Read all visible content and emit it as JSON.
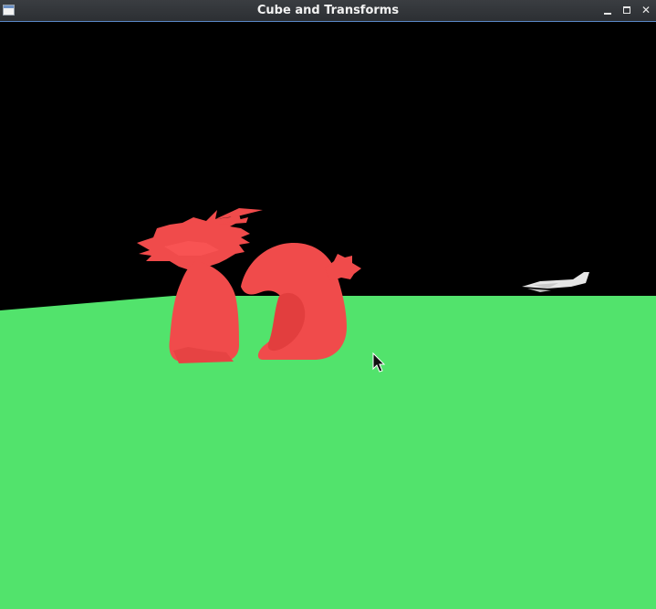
{
  "window": {
    "title": "Cube and Transforms",
    "icons": {
      "app": "window-app-icon",
      "minimize": "minimize-icon",
      "maximize": "maximize-icon",
      "close": "close-icon"
    }
  },
  "scene": {
    "background_color": "#000000",
    "ground_color": "#52e36c",
    "dragon_color": "#f04b4b",
    "plane_color": "#e6e6e6"
  }
}
